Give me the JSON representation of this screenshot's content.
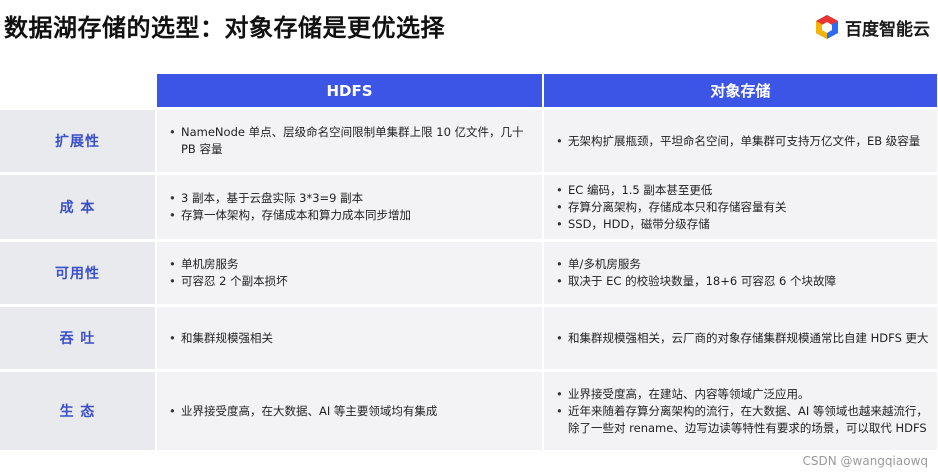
{
  "title": "数据湖存储的选型：对象存储是更优选择",
  "logo": {
    "text": "百度智能云",
    "icon": "baidu-cloud-logo-icon"
  },
  "table": {
    "headers": [
      "HDFS",
      "对象存储"
    ],
    "rows": [
      {
        "label": "扩展性",
        "hdfs": [
          "NameNode 单点、层级命名空间限制单集群上限 10 亿文件，几十 PB 容量"
        ],
        "object": [
          "无架构扩展瓶颈，平坦命名空间，单集群可支持万亿文件，EB 级容量"
        ]
      },
      {
        "label": "成 本",
        "hdfs": [
          "3 副本，基于云盘实际 3*3=9 副本",
          "存算一体架构，存储成本和算力成本同步增加"
        ],
        "object": [
          "EC 编码，1.5 副本甚至更低",
          "存算分离架构，存储成本只和存储容量有关",
          "SSD，HDD，磁带分级存储"
        ]
      },
      {
        "label": "可用性",
        "hdfs": [
          "单机房服务",
          "可容忍 2 个副本损坏"
        ],
        "object": [
          "单/多机房服务",
          "取决于 EC 的校验块数量，18+6 可容忍 6 个块故障"
        ]
      },
      {
        "label": "吞 吐",
        "hdfs": [
          "和集群规模强相关"
        ],
        "object": [
          "和集群规模强相关，云厂商的对象存储集群规模通常比自建 HDFS 更大"
        ]
      },
      {
        "label": "生 态",
        "hdfs": [
          "业界接受度高，在大数据、AI 等主要领域均有集成"
        ],
        "object": [
          "业界接受度高，在建站、内容等领域广泛应用。",
          "近年来随着存算分离架构的流行，在大数据、AI 等领域也越来越流行，除了一些对 rename、边写边读等特性有要求的场景，可以取代 HDFS"
        ]
      }
    ]
  },
  "watermark": "CSDN @wangqiaowq",
  "colors": {
    "header_bg": "#3d55e6",
    "label_text": "#3b50c8",
    "label_bg": "#e9eaee",
    "cell_bg": "#f3f3f5"
  }
}
